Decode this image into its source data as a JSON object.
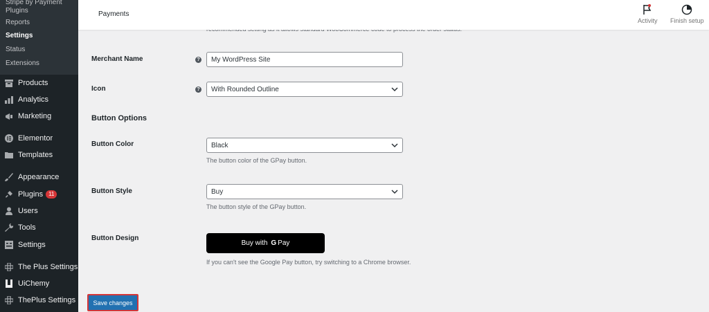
{
  "sidebar": {
    "submenu": [
      {
        "label": "Stripe by Payment Plugins",
        "current": false
      },
      {
        "label": "Reports",
        "current": false
      },
      {
        "label": "Settings",
        "current": true
      },
      {
        "label": "Status",
        "current": false
      },
      {
        "label": "Extensions",
        "current": false
      }
    ],
    "menu": [
      {
        "label": "Products",
        "icon": "archive-icon"
      },
      {
        "label": "Analytics",
        "icon": "bar-chart-icon"
      },
      {
        "label": "Marketing",
        "icon": "megaphone-icon"
      },
      {
        "label": "Elementor",
        "icon": "elementor-icon"
      },
      {
        "label": "Templates",
        "icon": "folder-icon"
      },
      {
        "label": "Appearance",
        "icon": "paintbrush-icon"
      },
      {
        "label": "Plugins",
        "icon": "plug-icon",
        "badge": "11"
      },
      {
        "label": "Users",
        "icon": "user-icon"
      },
      {
        "label": "Tools",
        "icon": "wrench-icon"
      },
      {
        "label": "Settings",
        "icon": "settings-icon"
      },
      {
        "label": "The Plus Settings",
        "icon": "plus-settings-icon"
      },
      {
        "label": "UiChemy",
        "icon": "uichemy-icon"
      },
      {
        "label": "ThePlus Settings",
        "icon": "plus-settings-icon"
      }
    ]
  },
  "topbar": {
    "title": "Payments",
    "activity_label": "Activity",
    "finish_setup_label": "Finish setup"
  },
  "main": {
    "cut_text": "recommended setting as it allows standard WooCommerce code to process the order status.",
    "merchant_name": {
      "label": "Merchant Name",
      "value": "My WordPress Site"
    },
    "icon": {
      "label": "Icon",
      "value": "With Rounded Outline"
    },
    "button_options_heading": "Button Options",
    "button_color": {
      "label": "Button Color",
      "value": "Black",
      "description": "The button color of the GPay button."
    },
    "button_style": {
      "label": "Button Style",
      "value": "Buy",
      "description": "The button style of the GPay button."
    },
    "button_design": {
      "label": "Button Design",
      "preview_prefix": "Buy with",
      "preview_g": "G",
      "preview_suffix": "Pay",
      "description": "If you can't see the Google Pay button, try switching to a Chrome browser."
    },
    "save_label": "Save changes"
  },
  "colors": {
    "sidebar_bg": "#1d2327",
    "primary_button": "#2271b1",
    "highlight_border": "#d63638",
    "badge": "#d63638"
  }
}
